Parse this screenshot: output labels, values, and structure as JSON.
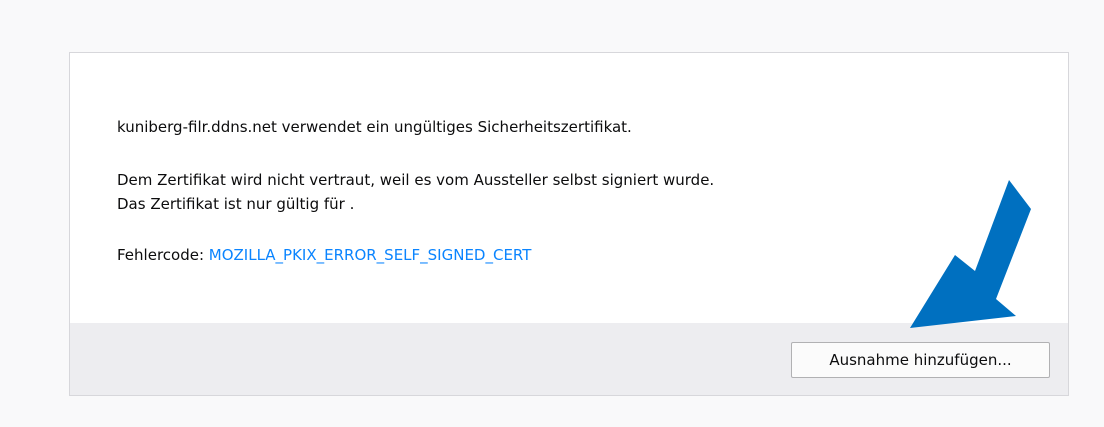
{
  "dialog": {
    "domain_message": "kuniberg-filr.ddns.net verwendet ein ungültiges Sicherheitszertifikat.",
    "untrusted_message": "Dem Zertifikat wird nicht vertraut, weil es vom Aussteller selbst signiert wurde.",
    "valid_for_message": "Das Zertifikat ist nur gültig für .",
    "error_code_label": "Fehlercode: ",
    "error_code_value": "MOZILLA_PKIX_ERROR_SELF_SIGNED_CERT",
    "add_exception_button": "Ausnahme hinzufügen..."
  },
  "annotation": {
    "arrow_color": "#0070c0"
  },
  "colors": {
    "link": "#0a84ff",
    "panel_footer": "#ededf0",
    "page_background": "#f9f9fa"
  }
}
